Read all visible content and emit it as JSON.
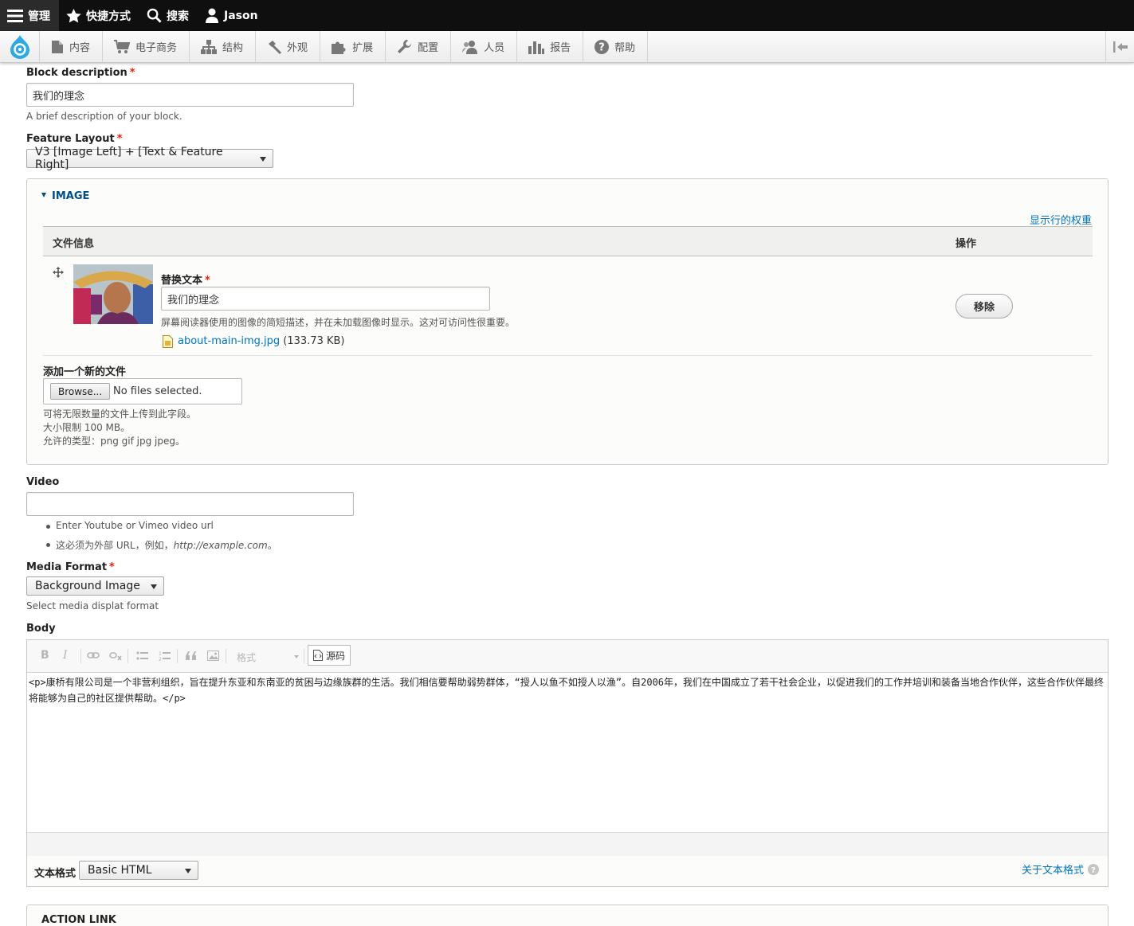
{
  "topbar": {
    "manage": "管理",
    "shortcuts": "快捷方式",
    "search": "搜索",
    "user": "Jason"
  },
  "tray": {
    "items": [
      {
        "label": "内容",
        "icon": "file-icon"
      },
      {
        "label": "电子商务",
        "icon": "cart-icon"
      },
      {
        "label": "结构",
        "icon": "sitemap-icon"
      },
      {
        "label": "外观",
        "icon": "hammer-icon"
      },
      {
        "label": "扩展",
        "icon": "puzzle-icon"
      },
      {
        "label": "配置",
        "icon": "wrench-icon"
      },
      {
        "label": "人员",
        "icon": "people-icon"
      },
      {
        "label": "报告",
        "icon": "bar-chart-icon"
      },
      {
        "label": "帮助",
        "icon": "help-icon"
      }
    ]
  },
  "block_description": {
    "label": "Block description",
    "required": "*",
    "value": "我们的理念",
    "help": "A brief description of your block."
  },
  "feature_layout": {
    "label": "Feature Layout",
    "required": "*",
    "value": "V3 [Image Left] + [Text & Feature Right]"
  },
  "image": {
    "legend": "IMAGE",
    "show_weights": "显示行的权重",
    "col_file_info": "文件信息",
    "col_operations": "操作",
    "alt_label": "替换文本",
    "alt_required": "*",
    "alt_value": "我们的理念",
    "alt_help": "屏幕阅读器使用的图像的简短描述，并在未加载图像时显示。这对可访问性很重要。",
    "file_name": "about-main-img.jpg",
    "file_size": "(133.73 KB)",
    "remove": "移除",
    "add_new_label": "添加一个新的文件",
    "browse": "Browse...",
    "no_files": "No files selected.",
    "help_1": "可将无限数量的文件上传到此字段。",
    "help_2": "大小限制 100 MB。",
    "help_3": "允许的类型：png gif jpg jpeg。"
  },
  "video": {
    "label": "Video",
    "value": "",
    "help_1": "Enter Youtube or Vimeo video url",
    "help_2a": "这必须为外部 URL，例如，",
    "help_2b": "http://example.com",
    "help_2c": "。"
  },
  "media_format": {
    "label": "Media Format",
    "required": "*",
    "value": "Background Image",
    "help": "Select media displat format"
  },
  "body": {
    "label": "Body",
    "format_placeholder": "格式",
    "source_label": "源码",
    "content": "<p>康桥有限公司是一个非营利组织，旨在提升东亚和东南亚的贫困与边缘族群的生活。我们相信要帮助弱势群体，“授人以鱼不如授人以渔”。自2006年，我们在中国成立了若干社会企业，以促进我们的工作并培训和装备当地合作伙伴，这些合作伙伴最终将能够为自己的社区提供帮助。</p>",
    "text_format_label": "文本格式",
    "text_format_value": "Basic HTML",
    "about_formats": "关于文本格式"
  },
  "action_link": {
    "legend": "ACTION LINK"
  },
  "colors": {
    "link": "#0074bd",
    "required": "#e62600",
    "topbar": "#0f0f0f"
  }
}
